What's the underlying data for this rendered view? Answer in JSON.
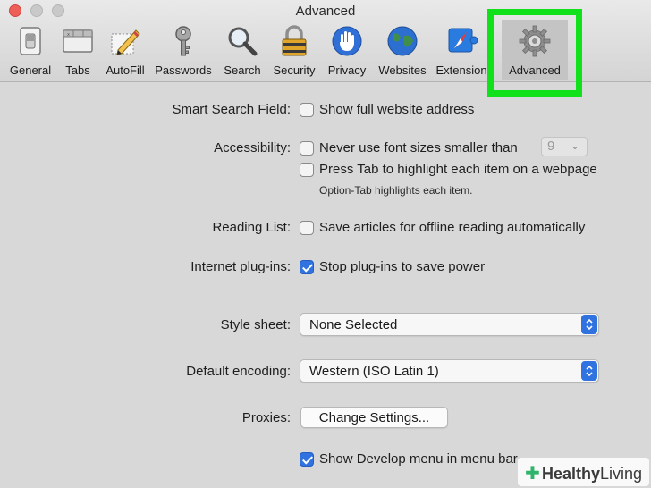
{
  "window": {
    "title": "Advanced"
  },
  "tabs": [
    {
      "label": "General",
      "icon": "general-switch-icon"
    },
    {
      "label": "Tabs",
      "icon": "tabs-icon"
    },
    {
      "label": "AutoFill",
      "icon": "autofill-pencil-icon"
    },
    {
      "label": "Passwords",
      "icon": "key-icon"
    },
    {
      "label": "Search",
      "icon": "magnifier-icon"
    },
    {
      "label": "Security",
      "icon": "padlock-icon"
    },
    {
      "label": "Privacy",
      "icon": "hand-icon"
    },
    {
      "label": "Websites",
      "icon": "globe-icon"
    },
    {
      "label": "Extensions",
      "display": "Extension",
      "icon": "puzzle-compass-icon"
    },
    {
      "label": "Advanced",
      "icon": "gear-icon",
      "active": true
    }
  ],
  "settings": {
    "smart_search": {
      "label": "Smart Search Field:",
      "option": "Show full website address",
      "checked": false
    },
    "accessibility": {
      "label": "Accessibility:",
      "option1": "Never use font sizes smaller than",
      "option1_checked": false,
      "font_size_value": "9",
      "option2": "Press Tab to highlight each item on a webpage",
      "option2_checked": false,
      "hint": "Option-Tab highlights each item."
    },
    "reading_list": {
      "label": "Reading List:",
      "option": "Save articles for offline reading automatically",
      "checked": false
    },
    "plugins": {
      "label": "Internet plug-ins:",
      "option": "Stop plug-ins to save power",
      "checked": true
    },
    "style_sheet": {
      "label": "Style sheet:",
      "value": "None Selected"
    },
    "encoding": {
      "label": "Default encoding:",
      "value": "Western (ISO Latin 1)"
    },
    "proxies": {
      "label": "Proxies:",
      "button": "Change Settings..."
    },
    "develop": {
      "option": "Show Develop menu in menu bar",
      "checked": true
    }
  },
  "watermark": {
    "text1": "Healthy",
    "text2": "Living"
  },
  "colors": {
    "accent": "#2f72e0",
    "highlight": "#11e11a",
    "close": "#ee5f57"
  }
}
